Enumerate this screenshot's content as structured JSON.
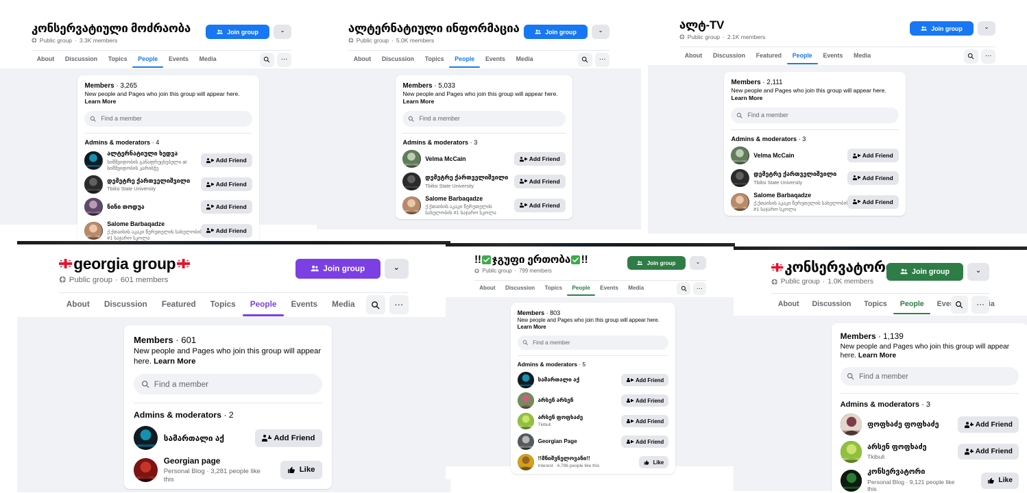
{
  "collage": {
    "background": "#ffffff",
    "description": "Six overlapping Facebook group People-tab screenshots"
  },
  "common": {
    "join_label": "Join group",
    "caret_label": "⌄",
    "search_placeholder": "Find a member",
    "members_label": "Members",
    "members_sub_prefix": "New people and Pages who join this group will appear here. ",
    "learn_more": "Learn More",
    "admins_label": "Admins & moderators",
    "add_friend_label": "Add Friend",
    "like_label": "Like",
    "public_group_label": "Public group",
    "globe_icon": "globe-icon",
    "search_icon": "search-icon",
    "more_icon": "···",
    "people_icon": "people-icon",
    "thumb_icon": "thumbs-up-icon"
  },
  "panels": [
    {
      "id": "konservatiuli-modzraoba",
      "title": "კონსერვატიული მოძრაობა",
      "title_flags": false,
      "privacy": "Public group",
      "member_count_text": "3.3K members",
      "accent": "#1877f2",
      "join_bg": "#1877f2",
      "tabs": [
        "About",
        "Discussion",
        "Topics",
        "People",
        "Events",
        "Media"
      ],
      "active_tab": "People",
      "members_count": "3,265",
      "admins_count": "4",
      "members": [
        {
          "name": "ალტერნატიული ხედვა",
          "sub": "სიმშვიდობის განაფრეცხებელი at სიმშვიდობის კარიბჭე",
          "action": "Add Friend",
          "avatar": "dark-teal-logo"
        },
        {
          "name": "დემეტრე ქართველიშვილი",
          "sub": "Tbilisi State University",
          "action": "Add Friend",
          "avatar": "dark-gray-portrait"
        },
        {
          "name": "ნინი თოდუა",
          "sub": "",
          "action": "Add Friend",
          "avatar": "purple-hair-portrait"
        },
        {
          "name": "Salome Barbaqadze",
          "sub": "ქ.ქთაისის აკაკი წერეთელის სახელობის #1 საჯარო სკოლა",
          "action": "Add Friend",
          "avatar": "beach-portrait"
        }
      ]
    },
    {
      "id": "alternatiuli-informacia",
      "title": "ალტერნატიული ინფორმაცია",
      "title_flags": false,
      "privacy": "Public group",
      "member_count_text": "5.0K members",
      "accent": "#1877f2",
      "join_bg": "#1877f2",
      "tabs": [
        "About",
        "Discussion",
        "Topics",
        "People",
        "Events",
        "Media"
      ],
      "active_tab": "People",
      "members_count": "5,033",
      "admins_count": "3",
      "members": [
        {
          "name": "Velma McCain",
          "sub": "",
          "action": "Add Friend",
          "avatar": "mountain-photo"
        },
        {
          "name": "დემეტრე ქართველიშვილი",
          "sub": "Tbilisi State University",
          "action": "Add Friend",
          "avatar": "dark-gray-portrait"
        },
        {
          "name": "Salome Barbaqadze",
          "sub": "ქ.ქთაისის აკაკი წერეთელის სახელობის #1 საჯარო სკოლა",
          "action": "Add Friend",
          "avatar": "beach-portrait"
        }
      ]
    },
    {
      "id": "alt-tv",
      "title": "ალტ-TV",
      "title_flags": false,
      "privacy": "Public group",
      "member_count_text": "2.1K members",
      "accent": "#1877f2",
      "join_bg": "#1877f2",
      "tabs": [
        "About",
        "Discussion",
        "Featured",
        "People",
        "Events",
        "Media"
      ],
      "active_tab": "People",
      "members_count": "2,111",
      "admins_count": "3",
      "members": [
        {
          "name": "Velma McCain",
          "sub": "",
          "action": "Add Friend",
          "avatar": "mountain-photo"
        },
        {
          "name": "დემეტრე ქართველიშვილი",
          "sub": "Tbilisi State University",
          "action": "Add Friend",
          "avatar": "dark-gray-portrait"
        },
        {
          "name": "Salome Barbaqadze",
          "sub": "ქ.ქთაისის აკაკი წერეთელის სახელობის #1 საჯარო სკოლა",
          "action": "Add Friend",
          "avatar": "beach-portrait"
        }
      ]
    },
    {
      "id": "georgia-group",
      "title": "georgia group",
      "title_flags": true,
      "privacy": "Public group",
      "member_count_text": "601 members",
      "accent": "#7b3fe4",
      "join_bg": "#7b3fe4",
      "tabs": [
        "About",
        "Discussion",
        "Featured",
        "Topics",
        "People",
        "Events",
        "Media"
      ],
      "active_tab": "People",
      "members_count": "601",
      "admins_count": "2",
      "members": [
        {
          "name": "სამართალი აქ",
          "sub": "",
          "action": "Add Friend",
          "avatar": "dark-teal-logo"
        },
        {
          "name": "Georgian page",
          "sub": "Personal Blog · 3,281 people like this",
          "action": "Like",
          "avatar": "red-black-logo"
        }
      ]
    },
    {
      "id": "jguphi-ertoba",
      "title": "!!✅ ჯგუფი ერთობა✅!!",
      "title_flags": false,
      "privacy": "Public group",
      "member_count_text": "799 members",
      "accent": "#2e7d46",
      "join_bg": "#2e7d46",
      "tabs": [
        "About",
        "Discussion",
        "Topics",
        "People",
        "Events",
        "Media"
      ],
      "active_tab": "People",
      "members_count": "803",
      "admins_count": "5",
      "members": [
        {
          "name": "სამართალი აქ",
          "sub": "",
          "action": "Add Friend",
          "avatar": "dark-teal-logo"
        },
        {
          "name": "არსენ არსენ",
          "sub": "",
          "action": "Add Friend",
          "avatar": "pink-shirt-photo"
        },
        {
          "name": "არსენ ფოფხაძე",
          "sub": "Tkibuli",
          "action": "Add Friend",
          "avatar": "green-grass-photo"
        },
        {
          "name": "Georgian Page",
          "sub": "",
          "action": "Add Friend",
          "avatar": "sunglasses-photo"
        },
        {
          "name": "!!მნიშვნელოვანი!!",
          "sub": "Interest · 4,796 people like this",
          "action": "Like",
          "avatar": "yellow-beard-photo"
        }
      ]
    },
    {
      "id": "konservatori",
      "title": "კონსერვატორი",
      "title_flags": true,
      "privacy": "Public group",
      "member_count_text": "1.0K members",
      "accent": "#2e7d46",
      "join_bg": "#2e7d46",
      "tabs": [
        "About",
        "Discussion",
        "Topics",
        "People",
        "Events",
        "Media"
      ],
      "active_tab": "People",
      "members_count": "1,139",
      "admins_count": "3",
      "members": [
        {
          "name": "ფოფხაძე ფოფხაძე",
          "sub": "",
          "action": "Add Friend",
          "avatar": "beard-maroon-photo"
        },
        {
          "name": "არსენ ფოფხაძე",
          "sub": "Tkibuli",
          "action": "Add Friend",
          "avatar": "green-grass-photo"
        },
        {
          "name": "კონსერვატორი",
          "sub": "Personal Blog · 9,121 people like this",
          "action": "Like",
          "avatar": "dark-green-logo"
        }
      ]
    }
  ]
}
